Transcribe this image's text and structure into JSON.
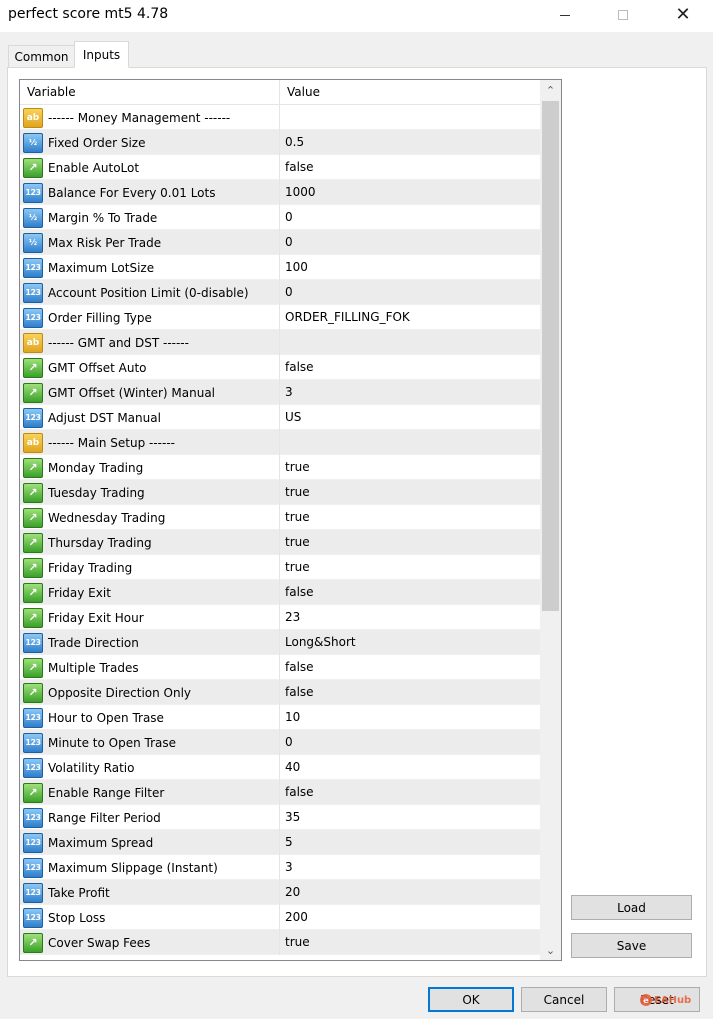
{
  "window": {
    "title": "perfect score mt5 4.78",
    "minimize_glyph": "—",
    "close_glyph": "✕"
  },
  "tabs": [
    {
      "label": "Common",
      "active": false
    },
    {
      "label": "Inputs",
      "active": true
    }
  ],
  "grid": {
    "col_variable": "Variable",
    "col_value": "Value",
    "scroll_up_glyph": "⌃",
    "scroll_down_glyph": "⌄",
    "rows": [
      {
        "icon": "string-ab-icon",
        "variable": "------ Money Management ------",
        "value": ""
      },
      {
        "icon": "double-half-icon",
        "variable": "Fixed Order Size",
        "value": "0.5"
      },
      {
        "icon": "bool-icon",
        "variable": "Enable AutoLot",
        "value": "false"
      },
      {
        "icon": "int-123-icon",
        "variable": "Balance For Every 0.01 Lots",
        "value": "1000"
      },
      {
        "icon": "double-half-icon",
        "variable": "Margin % To Trade",
        "value": "0"
      },
      {
        "icon": "double-half-icon",
        "variable": "Max Risk Per Trade",
        "value": "0"
      },
      {
        "icon": "int-123-icon",
        "variable": "Maximum LotSize",
        "value": "100"
      },
      {
        "icon": "int-123-icon",
        "variable": "Account Position Limit (0-disable)",
        "value": "0"
      },
      {
        "icon": "int-123-icon",
        "variable": "Order Filling Type",
        "value": "ORDER_FILLING_FOK"
      },
      {
        "icon": "string-ab-icon",
        "variable": "------ GMT and DST ------",
        "value": ""
      },
      {
        "icon": "bool-icon",
        "variable": "GMT Offset Auto",
        "value": "false"
      },
      {
        "icon": "bool-icon",
        "variable": "GMT Offset (Winter) Manual",
        "value": "3"
      },
      {
        "icon": "int-123-icon",
        "variable": "Adjust DST Manual",
        "value": "US"
      },
      {
        "icon": "string-ab-icon",
        "variable": "------ Main Setup ------",
        "value": ""
      },
      {
        "icon": "bool-icon",
        "variable": "Monday Trading",
        "value": "true"
      },
      {
        "icon": "bool-icon",
        "variable": "Tuesday Trading",
        "value": "true"
      },
      {
        "icon": "bool-icon",
        "variable": "Wednesday Trading",
        "value": "true"
      },
      {
        "icon": "bool-icon",
        "variable": "Thursday Trading",
        "value": "true"
      },
      {
        "icon": "bool-icon",
        "variable": "Friday Trading",
        "value": "true"
      },
      {
        "icon": "bool-icon",
        "variable": "Friday Exit",
        "value": "false"
      },
      {
        "icon": "bool-icon",
        "variable": "Friday Exit Hour",
        "value": "23"
      },
      {
        "icon": "int-123-icon",
        "variable": "Trade Direction",
        "value": "Long&Short"
      },
      {
        "icon": "bool-icon",
        "variable": "Multiple Trades",
        "value": "false"
      },
      {
        "icon": "bool-icon",
        "variable": "Opposite Direction Only",
        "value": "false"
      },
      {
        "icon": "int-123-icon",
        "variable": "Hour to Open Trase",
        "value": "10"
      },
      {
        "icon": "int-123-icon",
        "variable": "Minute to Open Trase",
        "value": "0"
      },
      {
        "icon": "int-123-icon",
        "variable": "Volatility Ratio",
        "value": "40"
      },
      {
        "icon": "bool-icon",
        "variable": "Enable Range Filter",
        "value": "false"
      },
      {
        "icon": "int-123-icon",
        "variable": "Range Filter Period",
        "value": "35"
      },
      {
        "icon": "int-123-icon",
        "variable": "Maximum Spread",
        "value": "5"
      },
      {
        "icon": "int-123-icon",
        "variable": "Maximum Slippage (Instant)",
        "value": "3"
      },
      {
        "icon": "int-123-icon",
        "variable": "Take Profit",
        "value": "20"
      },
      {
        "icon": "int-123-icon",
        "variable": "Stop Loss",
        "value": "200"
      },
      {
        "icon": "bool-icon",
        "variable": "Cover Swap Fees",
        "value": "true"
      }
    ]
  },
  "buttons": {
    "load": "Load",
    "save": "Save",
    "ok": "OK",
    "cancel": "Cancel",
    "reset": "Reset"
  },
  "watermark": {
    "text": "EAHub"
  },
  "colors": {
    "accent": "#0078d7",
    "row_alt": "#ececec"
  }
}
